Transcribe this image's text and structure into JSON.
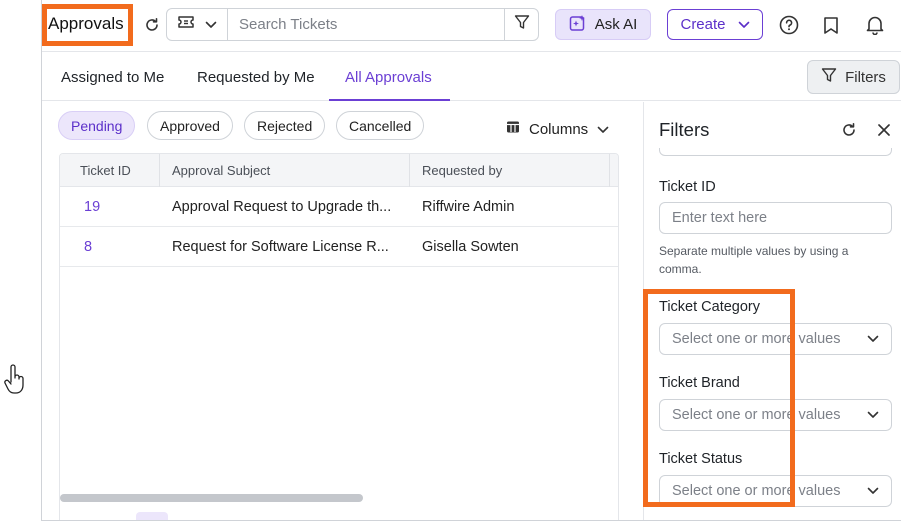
{
  "header": {
    "title": "Approvals",
    "search_placeholder": "Search Tickets",
    "ask_ai_label": "Ask AI",
    "create_label": "Create"
  },
  "tabs": [
    {
      "label": "Assigned to Me",
      "active": false
    },
    {
      "label": "Requested by Me",
      "active": false
    },
    {
      "label": "All Approvals",
      "active": true
    }
  ],
  "filters_button_label": "Filters",
  "status_chips": [
    {
      "label": "Pending",
      "active": true
    },
    {
      "label": "Approved",
      "active": false
    },
    {
      "label": "Rejected",
      "active": false
    },
    {
      "label": "Cancelled",
      "active": false
    }
  ],
  "columns_label": "Columns",
  "table": {
    "headers": [
      "Ticket ID",
      "Approval Subject",
      "Requested by"
    ],
    "rows": [
      {
        "id": "19",
        "subject": "Approval Request to Upgrade th...",
        "requested_by": "Riffwire Admin"
      },
      {
        "id": "8",
        "subject": "Request for Software License R...",
        "requested_by": "Gisella Sowten"
      }
    ]
  },
  "filters_panel": {
    "title": "Filters",
    "ticket_id": {
      "label": "Ticket ID",
      "placeholder": "Enter text here",
      "help": "Separate multiple values by using a comma."
    },
    "ticket_category": {
      "label": "Ticket Category",
      "placeholder": "Select one or more values"
    },
    "ticket_brand": {
      "label": "Ticket Brand",
      "placeholder": "Select one or more values"
    },
    "ticket_status": {
      "label": "Ticket Status",
      "placeholder": "Select one or more values"
    }
  },
  "colors": {
    "accent": "#6b3fd4",
    "highlight": "#f26b1d"
  },
  "icons": [
    "refresh-icon",
    "ticket-icon",
    "chevron-down-icon",
    "filter-icon",
    "sparkle-icon",
    "help-icon",
    "bookmark-icon",
    "bell-icon",
    "columns-icon",
    "close-icon",
    "hand-cursor-icon"
  ]
}
